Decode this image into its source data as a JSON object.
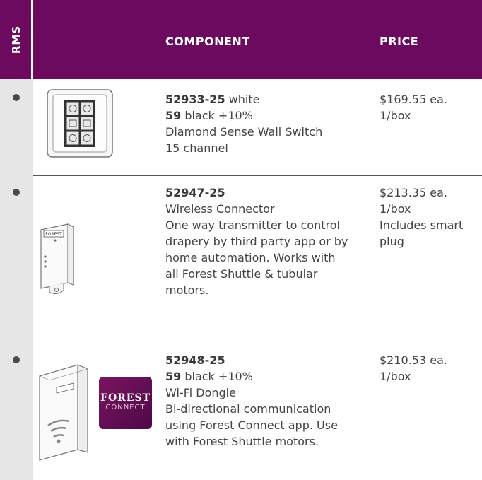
{
  "header": {
    "rms": "RMS",
    "component": "COMPONENT",
    "price": "PRICE"
  },
  "rows": [
    {
      "code": "52933-25",
      "code_suffix": " white",
      "variant_code": "59",
      "variant_suffix": " black +10%",
      "lines": [
        "Diamond Sense Wall Switch",
        "15 channel"
      ],
      "price": "$169.55 ea.",
      "price_lines": [
        "1/box"
      ]
    },
    {
      "code": "52947-25",
      "lines": [
        "Wireless Connector",
        "One way transmitter to control",
        "drapery by third party app or by",
        "home automation. Works with",
        "all Forest Shuttle & tubular",
        "motors."
      ],
      "price": "$213.35 ea.",
      "price_lines": [
        "1/box",
        "Includes smart",
        "plug"
      ]
    },
    {
      "code": "52948-25",
      "variant_code": "59",
      "variant_suffix": " black +10%",
      "lines": [
        "Wi-Fi Dongle",
        "Bi-directional communication",
        "using Forest Connect app. Use",
        "with Forest Shuttle motors."
      ],
      "price": "$210.53 ea.",
      "price_lines": [
        "1/box"
      ]
    }
  ],
  "logo": {
    "line1": "FOREST",
    "line2": "CONNECT"
  },
  "device_label": "FOREST",
  "colors": {
    "header": "#6b0a5e",
    "rms_column": "#e6e6e6",
    "text": "#444444"
  }
}
